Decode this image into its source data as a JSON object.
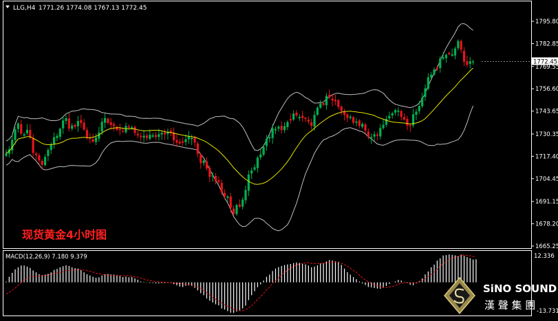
{
  "colors": {
    "background": "#000000",
    "frame": "#ffffff",
    "bull": "#00b050",
    "bear": "#e8141b",
    "bollinger": "#bfbfbf",
    "ma": "#e6e600",
    "macd_hist": "#ffffff",
    "macd_signal": "#e8141b",
    "price_label_bg": "#ffffff"
  },
  "header": {
    "symbol": "LLG,H4",
    "ohlc": "1771.26 1774.08 1767.13 1772.45",
    "collapse_icon": "triangle-down-icon"
  },
  "watermark": {
    "cn_title": "现货黄金4小时图"
  },
  "price_axis": {
    "ticks": [
      "1795.80",
      "1782.85",
      "1769.55",
      "1756.60",
      "1743.65",
      "1730.35",
      "1717.40",
      "1704.45",
      "1691.15",
      "1678.20",
      "1665.25"
    ],
    "current_price": "1772.45"
  },
  "macd": {
    "label": "MACD(12,26,9) 7.180 9.379",
    "axis_top": "12.336",
    "axis_bottom": "-13.731"
  },
  "logo": {
    "brand": "SiNO SOUND",
    "cn": "漢 聲 集 團",
    "emblem": "diamond-s-emblem-icon"
  },
  "chart_data": {
    "type": "candlestick",
    "timeframe": "H4",
    "ylim": [
      1665.25,
      1799
    ],
    "macd_ylim": [
      -13.731,
      12.336
    ],
    "close": [
      1719.2,
      1721.5,
      1727,
      1733,
      1736.5,
      1730.5,
      1730.2,
      1732.8,
      1728.3,
      1719.3,
      1718.1,
      1715,
      1712.5,
      1717,
      1721.1,
      1724.4,
      1728.5,
      1729.3,
      1733.4,
      1738.2,
      1739.5,
      1733.5,
      1735.3,
      1734.5,
      1737.9,
      1736.7,
      1732.9,
      1728.4,
      1727.6,
      1725.9,
      1728.3,
      1731.2,
      1737.4,
      1739.6,
      1736.8,
      1735.6,
      1734.9,
      1732.8,
      1732.6,
      1731.6,
      1735,
      1734.1,
      1734.3,
      1731,
      1729.6,
      1728.5,
      1729.3,
      1728.1,
      1729.9,
      1729.6,
      1728.6,
      1730.2,
      1731,
      1730.1,
      1731.6,
      1731,
      1726.7,
      1725.3,
      1724.8,
      1725.3,
      1727.3,
      1729.1,
      1728.1,
      1725.3,
      1718.8,
      1713.4,
      1714.9,
      1710.3,
      1705.5,
      1706.4,
      1702.8,
      1702.4,
      1696.3,
      1693.9,
      1694.1,
      1687.6,
      1684,
      1689.1,
      1688.1,
      1692.2,
      1697.8,
      1706.8,
      1709.2,
      1711,
      1716.6,
      1718.5,
      1722.8,
      1727.5,
      1728.5,
      1733.6,
      1733.3,
      1734.6,
      1732.6,
      1734.9,
      1737.3,
      1738.2,
      1742.2,
      1741.1,
      1740.3,
      1739.7,
      1739.1,
      1737.5,
      1735.1,
      1741.5,
      1745.6,
      1748.1,
      1747.3,
      1752.5,
      1751.6,
      1749.8,
      1749.4,
      1746.1,
      1743.7,
      1741.5,
      1739.7,
      1740.4,
      1736.9,
      1737.6,
      1735.1,
      1736.2,
      1732.3,
      1728.6,
      1728.6,
      1730.2,
      1729.3,
      1733.8,
      1735.7,
      1739.1,
      1740.8,
      1742.4,
      1744.2,
      1744,
      1740.3,
      1738.7,
      1735.2,
      1734.9,
      1741.8,
      1743.3,
      1746.6,
      1751.5,
      1756.9,
      1763.3,
      1764.8,
      1767.8,
      1768,
      1774.3,
      1774.9,
      1776.4,
      1776.7,
      1776.6,
      1780,
      1784.4,
      1779.3,
      1772.3,
      1770.5,
      1772.6,
      1772.5
    ],
    "macd_hist": [
      0.3,
      2.5,
      4.3,
      5.9,
      6.8,
      7.6,
      7.6,
      7.1,
      6.5,
      5.4,
      4.5,
      3.7,
      3.3,
      3.5,
      3.8,
      4.5,
      5.6,
      6.1,
      6.8,
      7.3,
      7.7,
      7.4,
      6.8,
      6.4,
      6.2,
      5.5,
      4.5,
      3.7,
      3.1,
      2.5,
      2.1,
      2.3,
      3.1,
      3.6,
      3.8,
      3.6,
      3.5,
      3.3,
      2.9,
      2.4,
      2.6,
      2.3,
      2.4,
      1.8,
      1.2,
      0.4,
      0.2,
      -0.1,
      -0.3,
      -0.3,
      -0.5,
      -0.5,
      -0.4,
      -0.4,
      -0.3,
      -0.2,
      -0.8,
      -1.4,
      -1.9,
      -2.1,
      -1.6,
      -1.4,
      -1.7,
      -2.5,
      -3.6,
      -4.9,
      -5.8,
      -7.3,
      -8.3,
      -9.1,
      -9.9,
      -10.4,
      -11.8,
      -12.3,
      -13,
      -13.7,
      -13.8,
      -13.2,
      -12.6,
      -11.8,
      -10.5,
      -8,
      -5.8,
      -4,
      -2.2,
      -0.9,
      0.8,
      2.5,
      3.5,
      5.1,
      6.2,
      6.9,
      7.4,
      7.8,
      8.1,
      8.3,
      8.7,
      9,
      8.8,
      8.4,
      8.1,
      7.6,
      6.8,
      7.1,
      7.7,
      8.5,
      8.6,
      9.4,
      10.1,
      9.9,
      9.5,
      9.1,
      7.9,
      6.2,
      4.6,
      3.5,
      2.4,
      1.4,
      0.4,
      -0.5,
      -1.2,
      -2.1,
      -2.3,
      -2.6,
      -2.8,
      -2.9,
      -2.3,
      -1.6,
      -0.7,
      0,
      0.4,
      1.1,
      0.8,
      0.1,
      -0.4,
      -1.1,
      -1.3,
      -0.5,
      0.6,
      1.8,
      3.6,
      4.9,
      6.8,
      8,
      9.8,
      10.8,
      12.1,
      12.3,
      12.6,
      12.4,
      12.2,
      11.8,
      12.5,
      12,
      11.4,
      10.9,
      10.3,
      10.4
    ],
    "macd_signal": [
      -5.2,
      -4.5,
      -3.6,
      -2.6,
      -1.3,
      -0.1,
      1,
      1.8,
      2.5,
      2.7,
      2.8,
      2.8,
      2.9,
      3.1,
      3.4,
      3.7,
      3.9,
      4.2,
      4.5,
      4.8,
      5.3,
      5.4,
      5.4,
      5.6,
      5.7,
      5.8,
      5.5,
      5.3,
      5,
      4.6,
      4.2,
      4,
      3.6,
      3.4,
      3.3,
      3.1,
      3,
      3.1,
      3.1,
      3,
      3,
      3,
      2.7,
      2.5,
      2.3,
      1.9,
      1.5,
      1.1,
      0.8,
      0.5,
      0.4,
      0.3,
      0.1,
      0,
      -0.1,
      -0.3,
      -0.3,
      -0.5,
      -0.5,
      -0.7,
      -0.9,
      -1,
      -1.4,
      -1.7,
      -2.2,
      -2.8,
      -3.6,
      -4.7,
      -5.7,
      -6.8,
      -7.6,
      -8.5,
      -9.2,
      -10.1,
      -10.8,
      -11.4,
      -12.2,
      -12.5,
      -12.8,
      -12.7,
      -12.4,
      -11.6,
      -10.6,
      -9.3,
      -7.7,
      -6.5,
      -5,
      -3.5,
      -2.1,
      -0.3,
      0.7,
      2.1,
      3.2,
      4.4,
      5.5,
      6.4,
      7.2,
      7.9,
      8.2,
      8.5,
      8.8,
      8.9,
      8.5,
      8.5,
      8.5,
      8.6,
      8.7,
      8.8,
      9,
      9.2,
      9.1,
      9.2,
      8.6,
      8,
      7.2,
      6.4,
      5.3,
      4.6,
      3.2,
      2.2,
      1.1,
      0.3,
      -0.4,
      -1,
      -1.6,
      -2.1,
      -2.3,
      -2.3,
      -2.1,
      -1.9,
      -1.4,
      -0.8,
      -0.4,
      -0.2,
      -0.2,
      -0.3,
      -0.3,
      -0.2,
      0.3,
      0.8,
      1.8,
      2.7,
      3.6,
      4.6,
      5.9,
      7.4,
      8.4,
      9.5,
      10.3,
      10.9,
      11.4,
      11.7,
      12,
      12.4,
      12.1,
      12,
      11.7,
      11.4
    ]
  }
}
